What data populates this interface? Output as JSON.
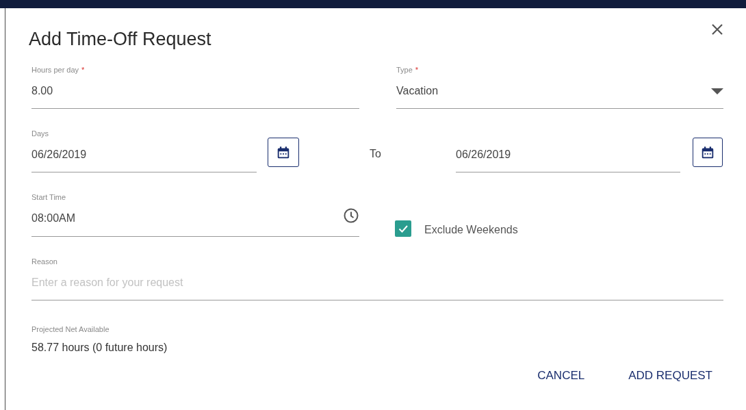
{
  "dialog": {
    "title": "Add Time-Off Request",
    "hours_per_day": {
      "label": "Hours per day",
      "required_mark": "*",
      "value": "8.00"
    },
    "type": {
      "label": "Type",
      "required_mark": "*",
      "value": "Vacation"
    },
    "days": {
      "label": "Days",
      "from": "06/26/2019",
      "separator": "To",
      "to": "06/26/2019"
    },
    "start_time": {
      "label": "Start Time",
      "value": "08:00AM"
    },
    "exclude_weekends": {
      "label": "Exclude Weekends",
      "checked": true
    },
    "reason": {
      "label": "Reason",
      "placeholder": "Enter a reason for your request"
    },
    "projected": {
      "label": "Projected Net Available",
      "value": "58.77 hours (0 future hours)"
    },
    "buttons": [
      {
        "label": "CANCEL"
      },
      {
        "label": "ADD REQUEST"
      }
    ]
  }
}
